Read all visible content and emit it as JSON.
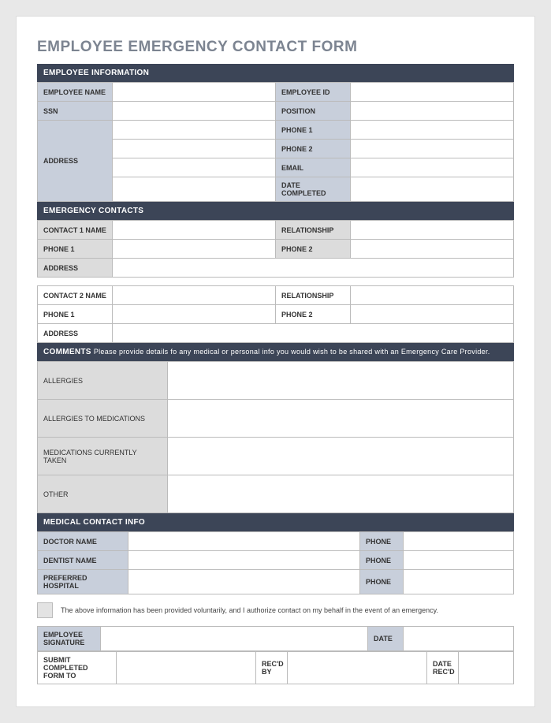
{
  "title": "EMPLOYEE EMERGENCY CONTACT FORM",
  "section_employee": "EMPLOYEE INFORMATION",
  "emp_name": "EMPLOYEE NAME",
  "emp_id": "EMPLOYEE ID",
  "ssn": "SSN",
  "position": "POSITION",
  "address": "ADDRESS",
  "phone1": "PHONE 1",
  "phone2": "PHONE 2",
  "email": "EMAIL",
  "date_completed": "DATE COMPLETED",
  "section_contacts": "EMERGENCY CONTACTS",
  "contact1_name": "CONTACT 1 NAME",
  "contact2_name": "CONTACT 2 NAME",
  "relationship": "RELATIONSHIP",
  "section_comments_prefix": "COMMENTS",
  "section_comments_note": "Please provide details fo any medical or personal info you would wish to be shared with an Emergency Care Provider.",
  "allergies": "ALLERGIES",
  "allergies_meds": "ALLERGIES TO MEDICATIONS",
  "meds_taken": "MEDICATIONS CURRENTLY TAKEN",
  "other": "OTHER",
  "section_medical": "MEDICAL CONTACT INFO",
  "doctor_name": "DOCTOR NAME",
  "dentist_name": "DENTIST NAME",
  "preferred_hospital": "PREFERRED HOSPITAL",
  "phone": "PHONE",
  "auth_text": "The above information has been provided voluntarily, and I authorize contact on my behalf in the event of an emergency.",
  "emp_signature": "EMPLOYEE SIGNATURE",
  "date": "DATE",
  "submit_to": "SUBMIT COMPLETED FORM TO",
  "recd_by": "REC'D BY",
  "date_recd": "DATE REC'D"
}
